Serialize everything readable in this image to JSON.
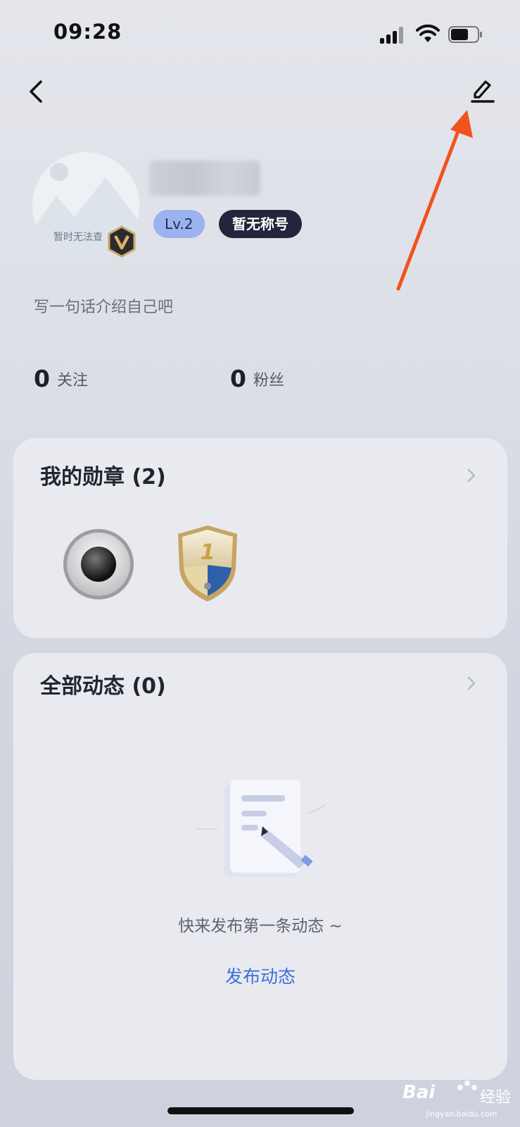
{
  "status_bar": {
    "time": "09:28"
  },
  "profile": {
    "avatar_caption": "暂时无法查",
    "level": "Lv.2",
    "title_tag": "暂无称号",
    "bio": "写一句话介绍自己吧"
  },
  "stats": {
    "following_count": "0",
    "following_label": "关注",
    "fans_count": "0",
    "fans_label": "粉丝"
  },
  "medals": {
    "title": "我的勋章 (2)"
  },
  "feed": {
    "title": "全部动态 (0)",
    "empty_text": "快来发布第一条动态 ~",
    "publish_label": "发布动态"
  },
  "watermark": {
    "brand": "Bai",
    "brand_cn": "经验",
    "url": "jingyan.baidu.com"
  },
  "colors": {
    "accent": "#3d6fd6",
    "arrow": "#f0531c",
    "level_tag": "#9ab2ef",
    "title_tag": "#22263a"
  }
}
